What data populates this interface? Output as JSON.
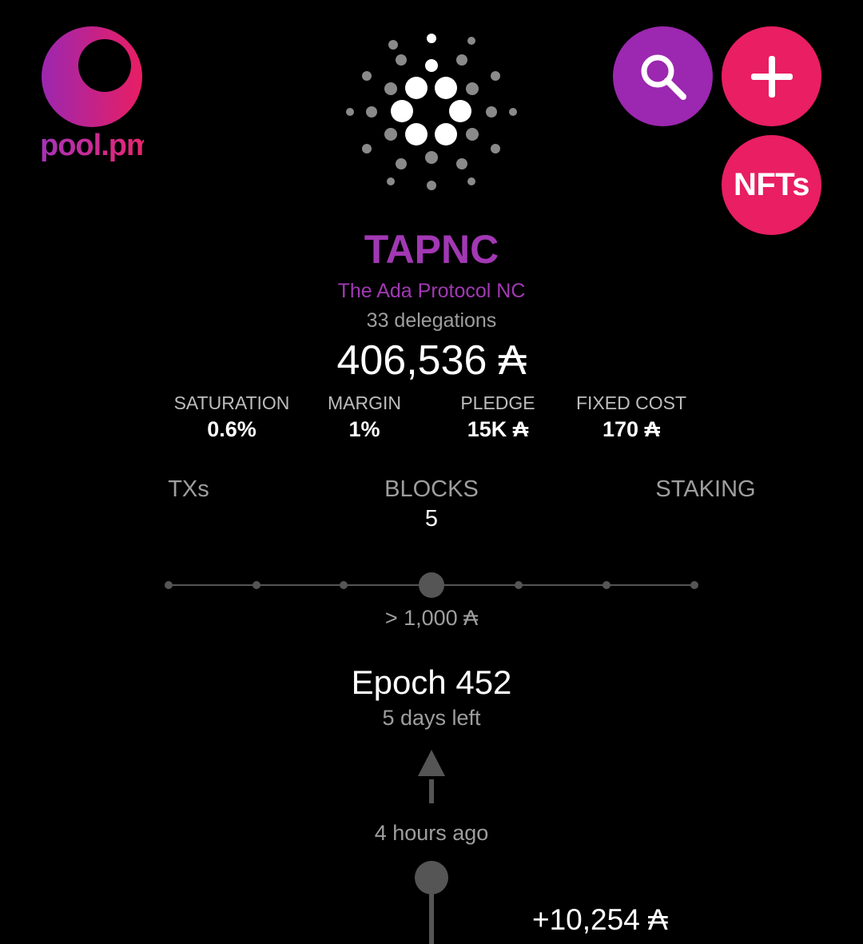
{
  "header": {
    "logo_text": "pool.pm",
    "search_icon": "search-icon",
    "add_icon": "plus-icon",
    "nfts_label": "NFTs",
    "center_icon": "cardano-icon"
  },
  "pool": {
    "ticker": "TAPNC",
    "name": "The Ada Protocol NC",
    "delegations": "33 delegations",
    "stake": "406,536 ₳"
  },
  "stats": [
    {
      "label": "SATURATION",
      "value": "0.6%"
    },
    {
      "label": "MARGIN",
      "value": "1%"
    },
    {
      "label": "PLEDGE",
      "value": "15K ₳"
    },
    {
      "label": "FIXED COST",
      "value": "170 ₳"
    }
  ],
  "tabs": [
    {
      "label": "TXs",
      "count": ""
    },
    {
      "label": "BLOCKS",
      "count": "5"
    },
    {
      "label": "STAKING",
      "count": ""
    }
  ],
  "filter": {
    "label": "> 1,000 ₳",
    "steps": 7,
    "selected_index": 3
  },
  "epoch": {
    "title": "Epoch 452",
    "remaining": "5 days left"
  },
  "timeline": {
    "time_ago": "4 hours ago",
    "tx_amount": "+10,254 ₳",
    "tx_sub": "..."
  },
  "colors": {
    "purple": "#9c27b0",
    "pink": "#e91e63",
    "ticker": "#a238b4",
    "muted": "#9e9e9e",
    "timeline": "#555555"
  }
}
